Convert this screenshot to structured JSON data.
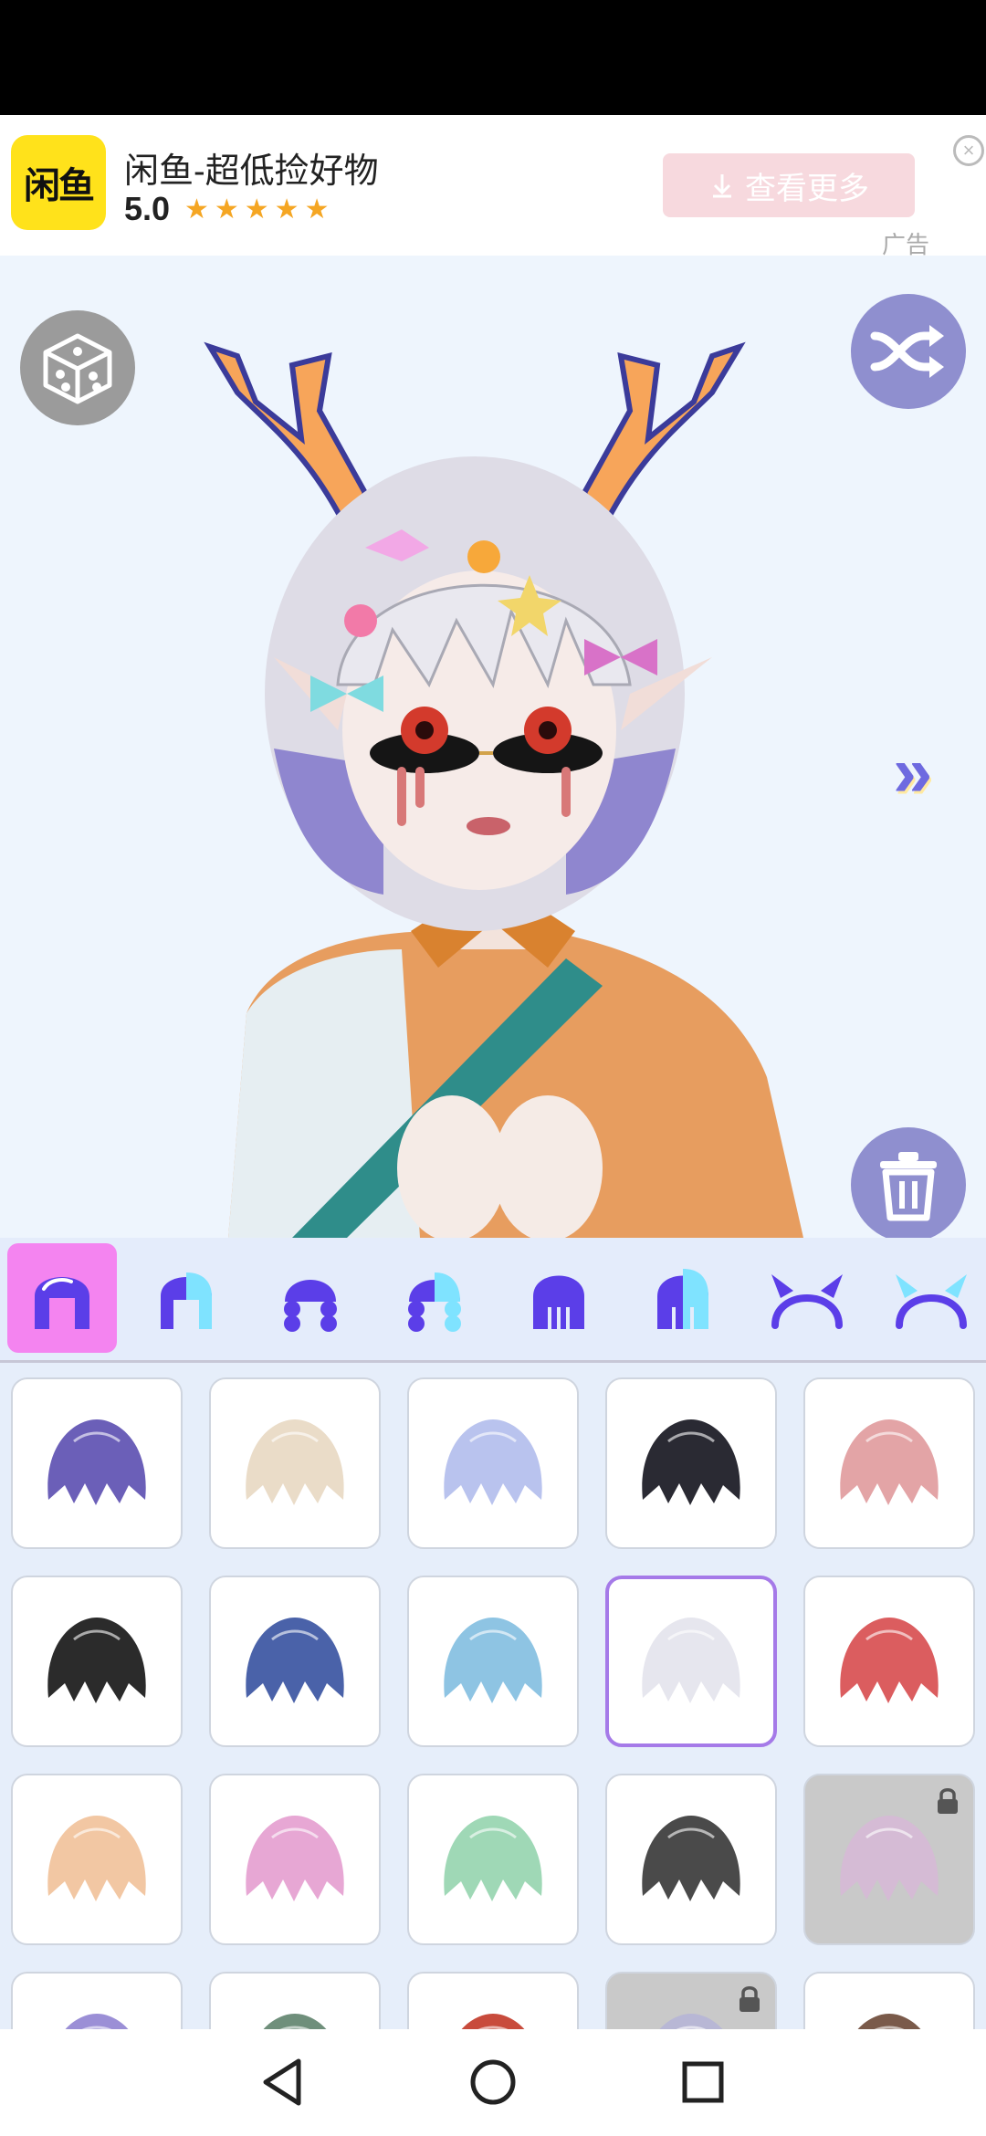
{
  "ad": {
    "logo_text": "闲鱼",
    "title": "闲鱼-超低捡好物",
    "rating": "5.0",
    "stars": "★★★★★",
    "button_label": "查看更多",
    "tag": "广告"
  },
  "colors": {
    "accent_purple": "#5b3ee8",
    "accent_cyan": "#7fe3ff",
    "active_tab": "#f484f0",
    "selected_border": "#a57ae8",
    "round_button_purple": "#8f8fcf"
  },
  "tabs": [
    {
      "name": "hair-style-1-icon"
    },
    {
      "name": "hair-style-2-icon"
    },
    {
      "name": "hair-style-3-icon"
    },
    {
      "name": "hair-style-4-icon"
    },
    {
      "name": "hair-style-5-icon"
    },
    {
      "name": "hair-style-6-icon"
    },
    {
      "name": "headband-horns-icon"
    },
    {
      "name": "headband-horns-2-icon"
    }
  ],
  "hair_grid": [
    {
      "color": "#6b5fb8"
    },
    {
      "color": "#eadcc8"
    },
    {
      "color": "#b9c3ee"
    },
    {
      "color": "#2a2a33"
    },
    {
      "color": "#e3a4a6"
    },
    {
      "color": "#2b2b2b"
    },
    {
      "color": "#4a62a9"
    },
    {
      "color": "#8ec4e3"
    },
    {
      "color": "#e6e6ee",
      "selected": true
    },
    {
      "color": "#db5d5f"
    },
    {
      "color": "#f2c7a3"
    },
    {
      "color": "#e7a7d4"
    },
    {
      "color": "#9fd8b6"
    },
    {
      "color": "#4a4a4a"
    },
    {
      "color": "#d8b6d8",
      "locked": true
    },
    {
      "color": "#9b8fd6"
    },
    {
      "color": "#6f8f7b"
    },
    {
      "color": "#c84b3c"
    },
    {
      "color": "#b2b0d8",
      "locked": true
    },
    {
      "color": "#7a5a4a"
    }
  ]
}
